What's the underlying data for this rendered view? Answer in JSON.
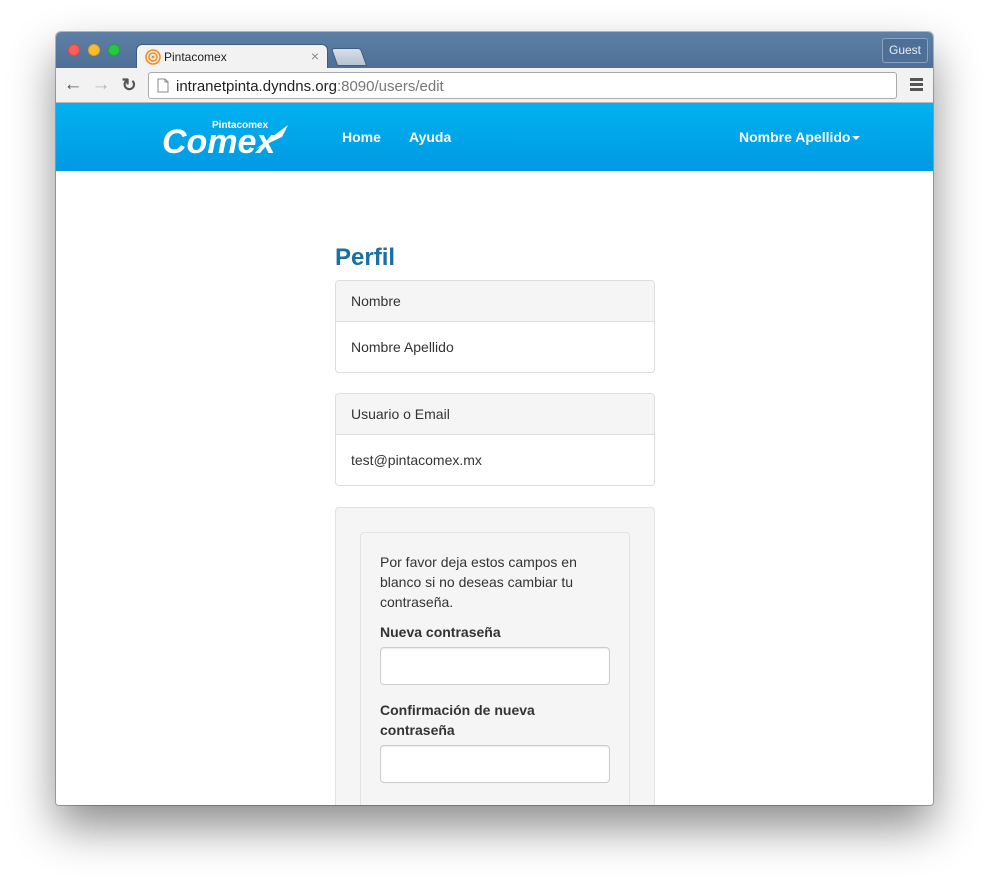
{
  "browser": {
    "tab_title": "Pintacomex",
    "tab_close": "×",
    "guest_label": "Guest",
    "url_host": "intranetpinta.dyndns.org",
    "url_path": ":8090/users/edit"
  },
  "navbar": {
    "logo_top": "Pintacomex",
    "logo_main": "Comex",
    "home_label": "Home",
    "help_label": "Ayuda",
    "user_label": "Nombre Apellido",
    "bg_color": "#00a6ea"
  },
  "profile": {
    "title": "Perfil",
    "name_heading": "Nombre",
    "name_value": "Nombre Apellido",
    "email_heading": "Usuario o Email",
    "email_value": "test@pintacomex.mx"
  },
  "password_form": {
    "help_text": "Por favor deja estos campos en blanco si no deseas cambiar tu contraseña.",
    "new_password_label": "Nueva contraseña",
    "new_password_value": "",
    "confirm_password_label": "Confirmación de nueva contraseña",
    "confirm_password_value": ""
  }
}
